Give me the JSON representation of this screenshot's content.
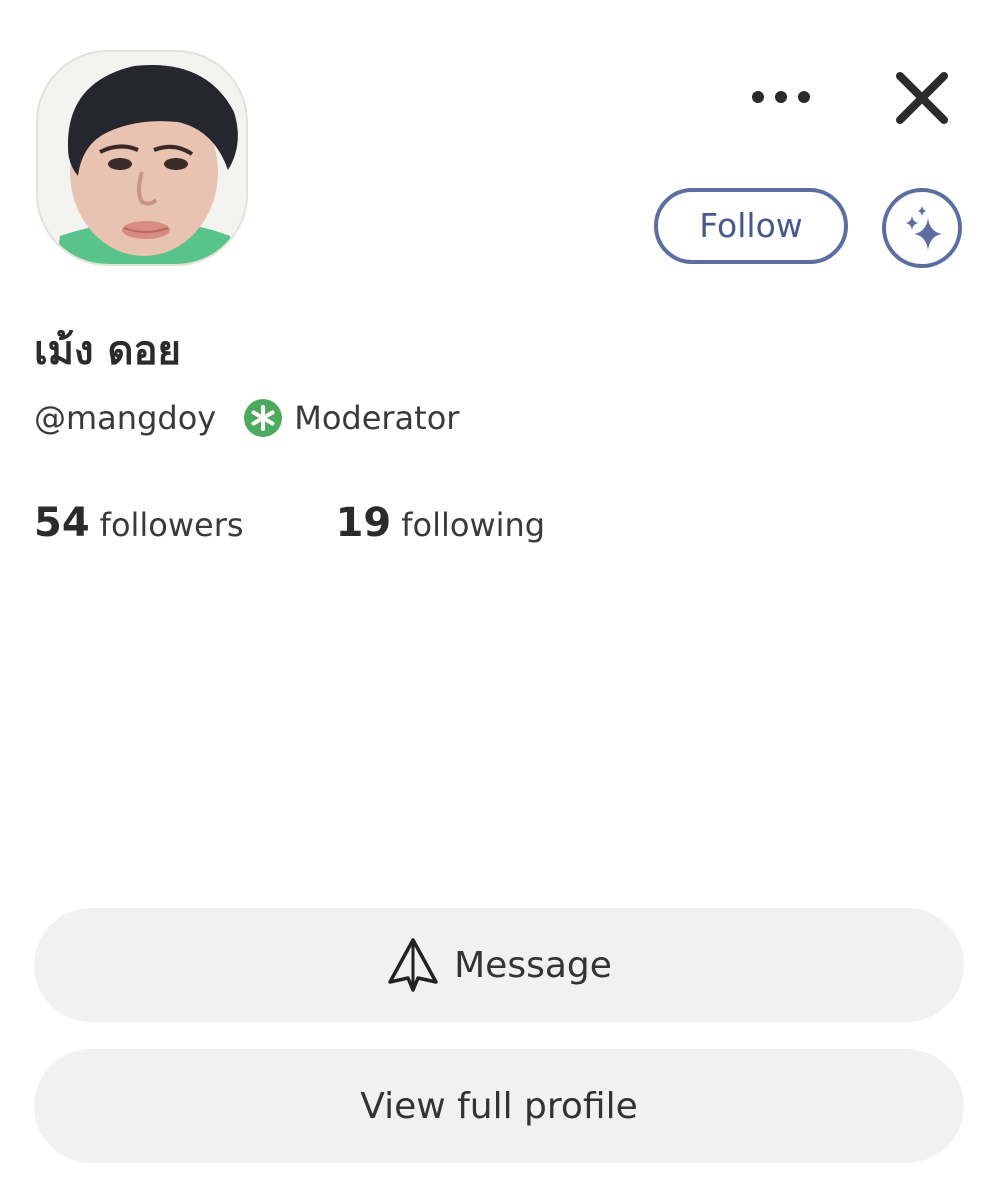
{
  "profile": {
    "display_name": "เม้ง ดอย",
    "handle": "@mangdoy",
    "role": "Moderator",
    "avatar_icon": "user-photo-avatar"
  },
  "header": {
    "more_icon": "ellipsis-icon",
    "close_icon": "close-icon"
  },
  "actions": {
    "follow_label": "Follow",
    "sparkle_icon": "sparkle-icon",
    "message_label": "Message",
    "message_icon": "paper-plane-icon",
    "view_profile_label": "View full profile"
  },
  "stats": {
    "followers_count": "54",
    "followers_label": "followers",
    "following_count": "19",
    "following_label": "following"
  },
  "colors": {
    "accent": "#5a6ea1",
    "moderator_badge": "#4caa5e",
    "button_bg": "#f1f1f1",
    "text": "#2b2b2b"
  }
}
